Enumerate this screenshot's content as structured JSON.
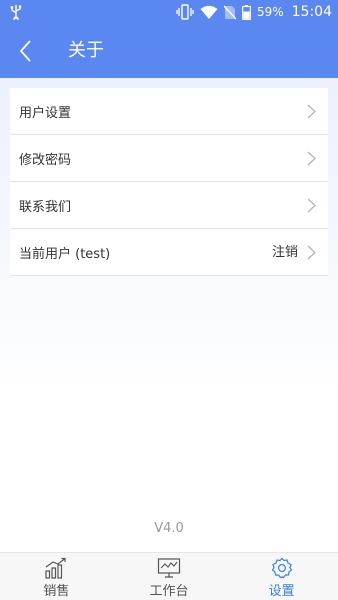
{
  "status_bar": {
    "battery_percent": "59%",
    "time": "15:04",
    "icons": [
      "usb-icon",
      "vibrate-icon",
      "wifi-icon",
      "no-sim-icon",
      "battery-icon"
    ]
  },
  "header": {
    "title": "关于",
    "back_icon": "back-chevron-icon"
  },
  "menu": {
    "items": [
      {
        "label": "用户设置",
        "extra": ""
      },
      {
        "label": "修改密码",
        "extra": ""
      },
      {
        "label": "联系我们",
        "extra": ""
      },
      {
        "label": "当前用户 (test)",
        "extra": "注销"
      }
    ]
  },
  "version": "V4.0",
  "tabbar": {
    "tabs": [
      {
        "label": "销售",
        "icon": "sales-chart-icon",
        "active": false
      },
      {
        "label": "工作台",
        "icon": "monitor-icon",
        "active": false
      },
      {
        "label": "设置",
        "icon": "gear-icon",
        "active": true
      }
    ]
  },
  "colors": {
    "primary": "#5b87f0",
    "active_tab": "#3a7fe0"
  }
}
